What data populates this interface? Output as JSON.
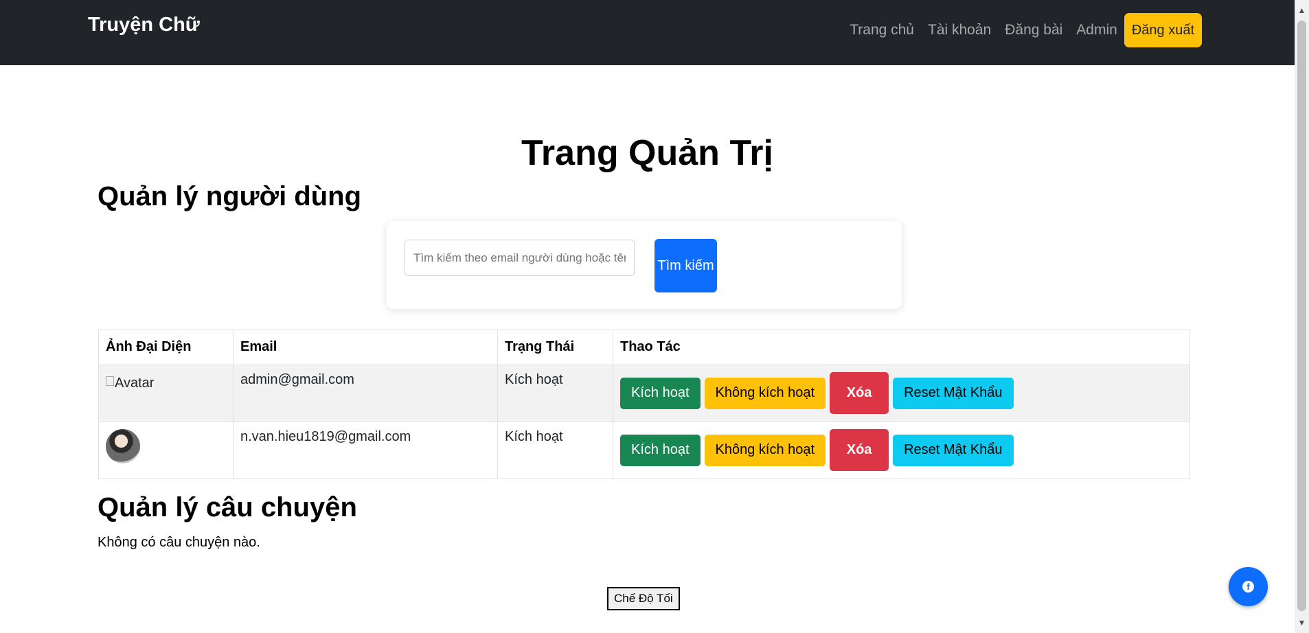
{
  "navbar": {
    "brand": "Truyện Chữ",
    "links": [
      "Trang chủ",
      "Tài khoản",
      "Đăng bài",
      "Admin"
    ],
    "logout_label": "Đăng xuất"
  },
  "page": {
    "title": "Trang Quản Trị",
    "users_section_title": "Quản lý người dùng",
    "stories_section_title": "Quản lý câu chuyện",
    "no_stories_text": "Không có câu chuyện nào.",
    "dark_mode_label": "Chế Độ Tối"
  },
  "search": {
    "placeholder": "Tìm kiếm theo email người dùng hoặc tên",
    "button_label": "Tìm kiếm"
  },
  "table": {
    "headers": [
      "Ảnh Đại Diện",
      "Email",
      "Trạng Thái",
      "Thao Tác"
    ],
    "rows": [
      {
        "avatar_alt": "Avatar",
        "email": "admin@gmail.com",
        "status": "Kích hoạt"
      },
      {
        "avatar_alt": "",
        "email": "n.van.hieu1819@gmail.com",
        "status": "Kích hoạt"
      }
    ],
    "actions": {
      "activate": "Kích hoạt",
      "deactivate": "Không kích hoạt",
      "delete": "Xóa",
      "reset_password": "Reset Mật Khẩu"
    }
  },
  "colors": {
    "navbar_bg": "#212529",
    "primary": "#0d6efd",
    "success": "#198754",
    "warning": "#ffc107",
    "danger": "#dc3545",
    "info": "#0dcaf0"
  },
  "icons": {
    "fab": "chat-icon"
  }
}
